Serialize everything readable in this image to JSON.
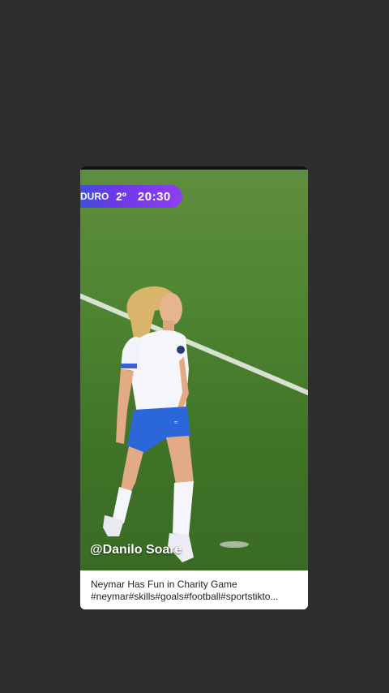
{
  "video": {
    "scoreboard": {
      "team": "DURO",
      "half": "2º",
      "clock": "20:30"
    },
    "watermark": "@Danilo Soare"
  },
  "caption": {
    "title": "Neymar Has Fun in Charity Game",
    "hashtags": "#neymar#skills#goals#football#sportstikto..."
  },
  "colors": {
    "background": "#2f2d2d",
    "field": "#4f8431",
    "scorebar_start": "#3e52d8",
    "scorebar_end": "#8e3ff0"
  }
}
